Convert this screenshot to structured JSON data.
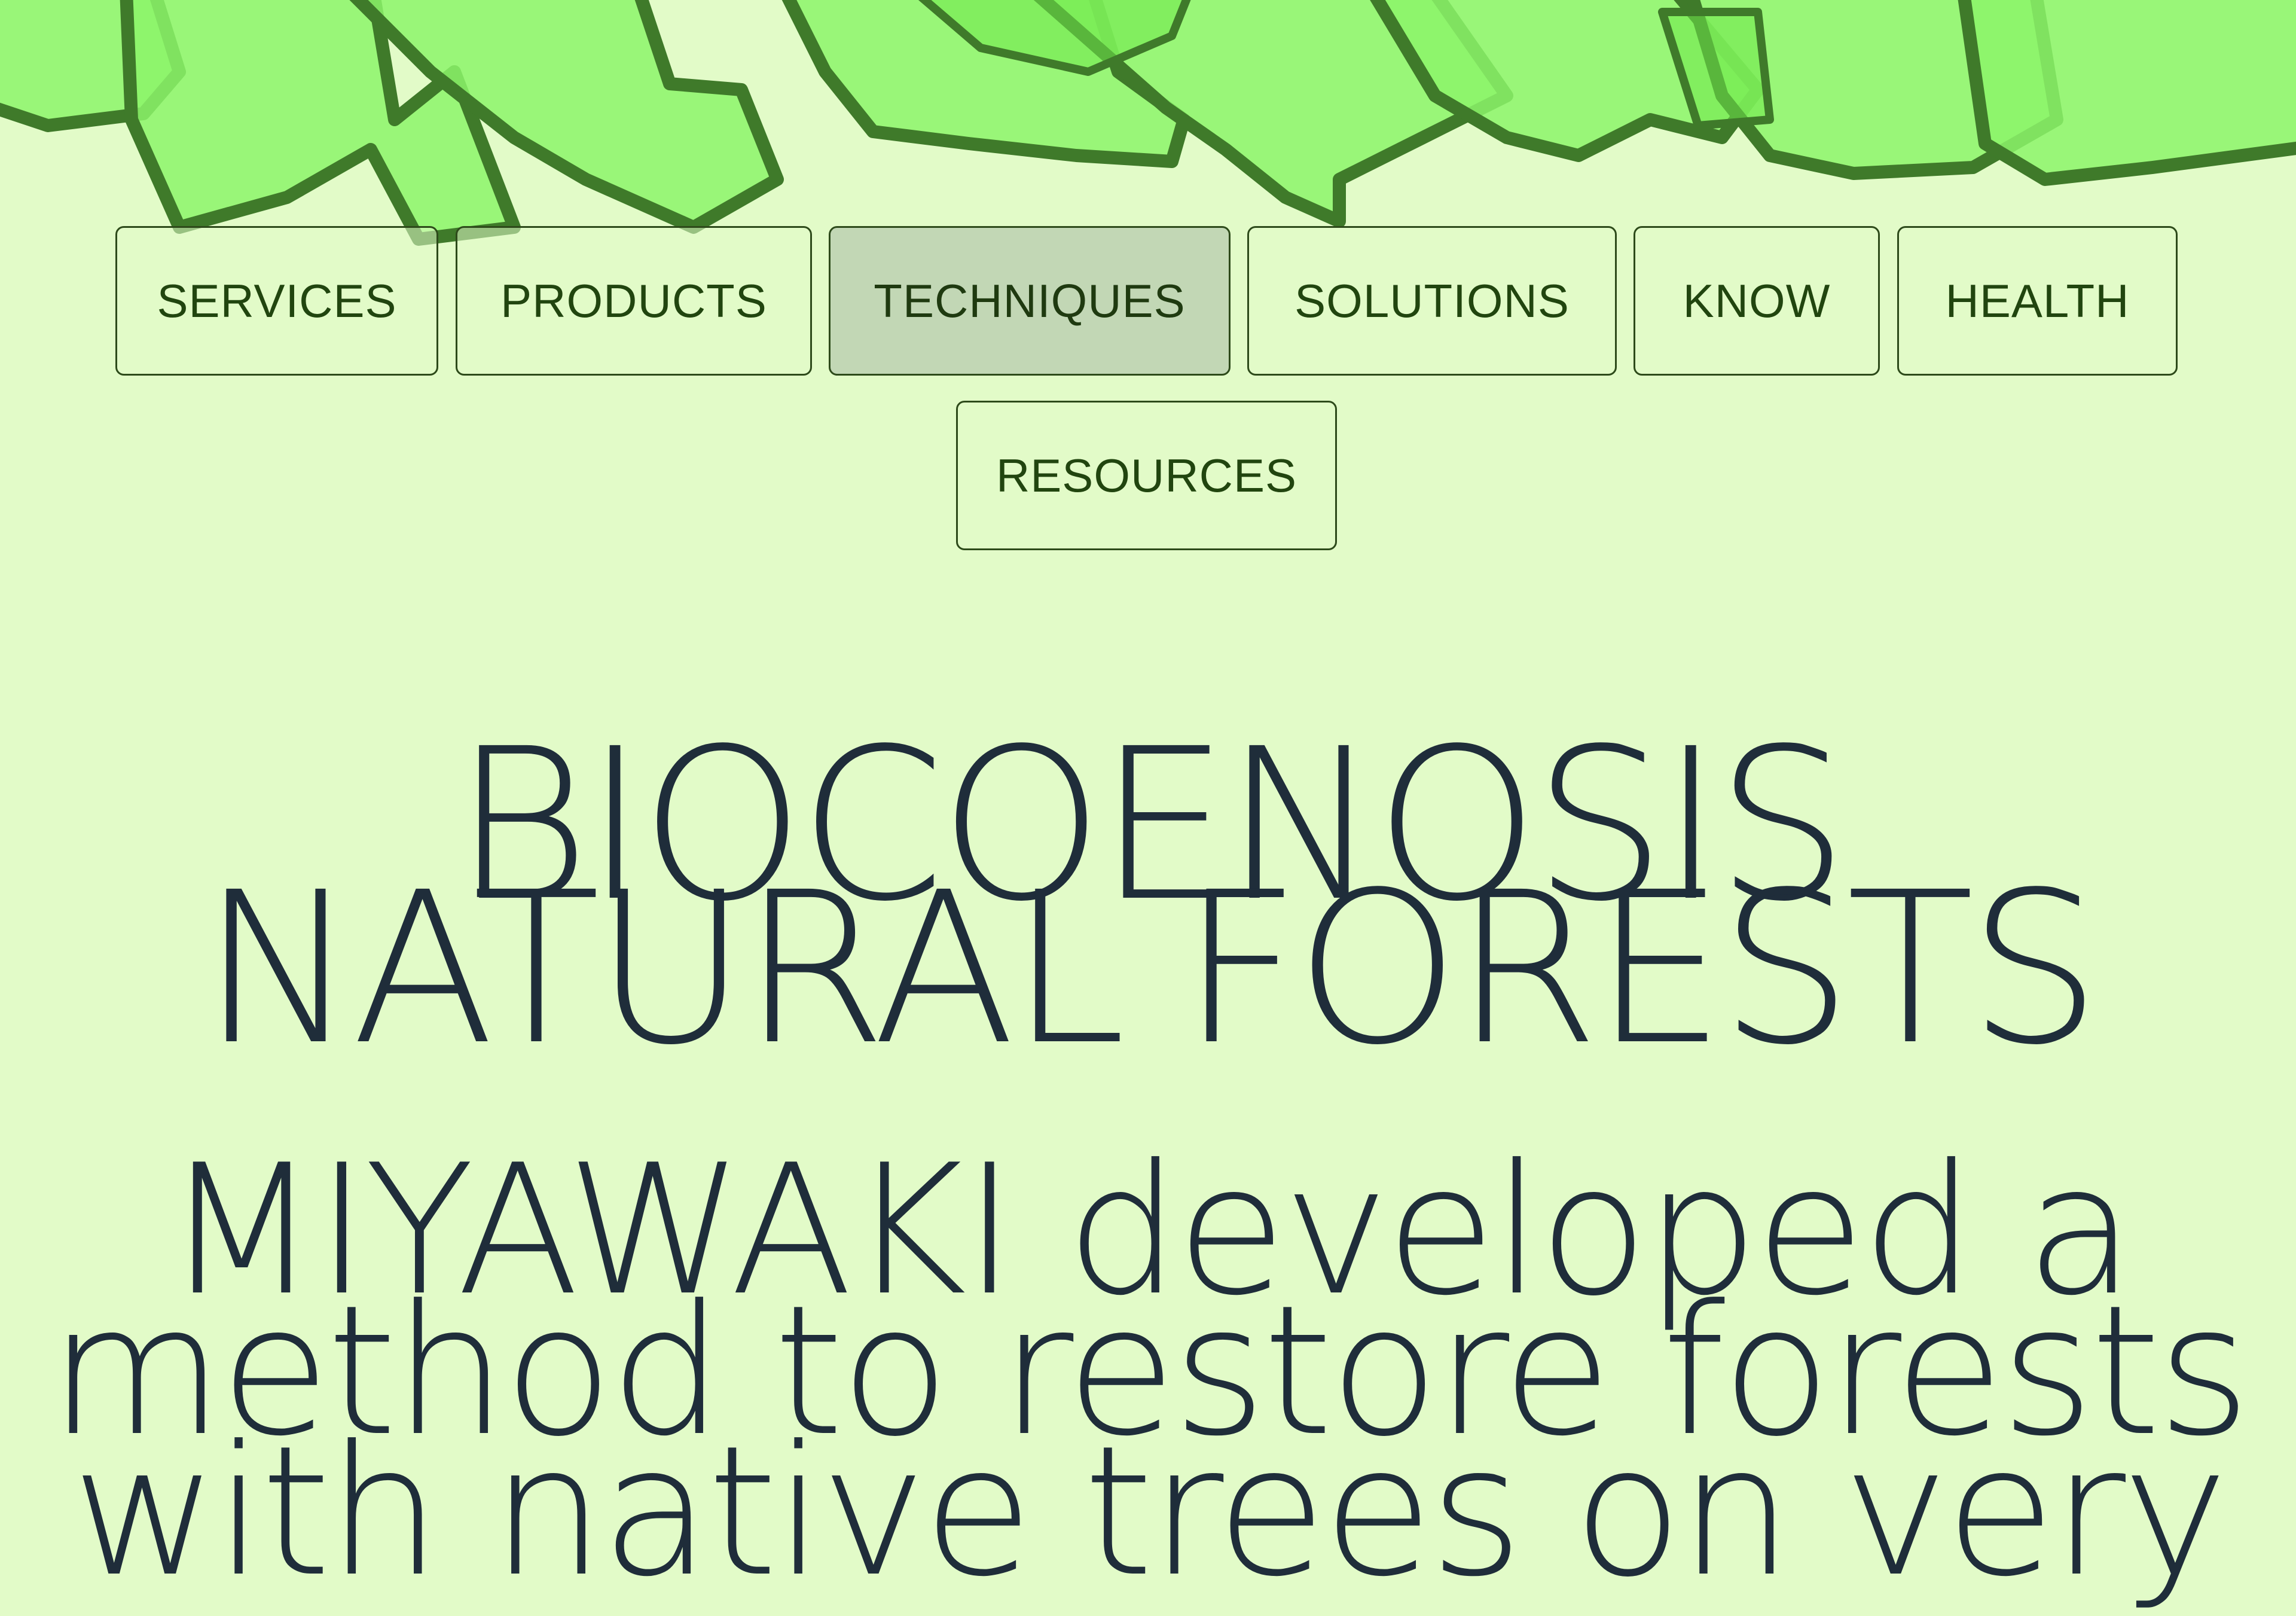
{
  "nav": {
    "items": [
      {
        "label": "SERVICES",
        "active": false
      },
      {
        "label": "PRODUCTS",
        "active": false
      },
      {
        "label": "TECHNIQUES",
        "active": true
      },
      {
        "label": "SOLUTIONS",
        "active": false
      },
      {
        "label": "KNOW",
        "active": false
      },
      {
        "label": "HEALTH",
        "active": false
      },
      {
        "label": "RESOURCES",
        "active": false
      }
    ]
  },
  "hero": {
    "title_line_1": "BIOCOENOSIS",
    "title_line_2": "NATURAL FORESTS"
  },
  "intro": {
    "lines": [
      "MIYAWAKI developed a",
      "method to restore forests",
      "with native trees on very"
    ]
  },
  "colors": {
    "background": "#e2fbc8",
    "logo_fill": "#8cf56a",
    "logo_stroke": "#3f7a2a",
    "text": "#1f2d3a",
    "nav_text": "#21450f",
    "nav_active_bg": "#c2d7b5"
  }
}
